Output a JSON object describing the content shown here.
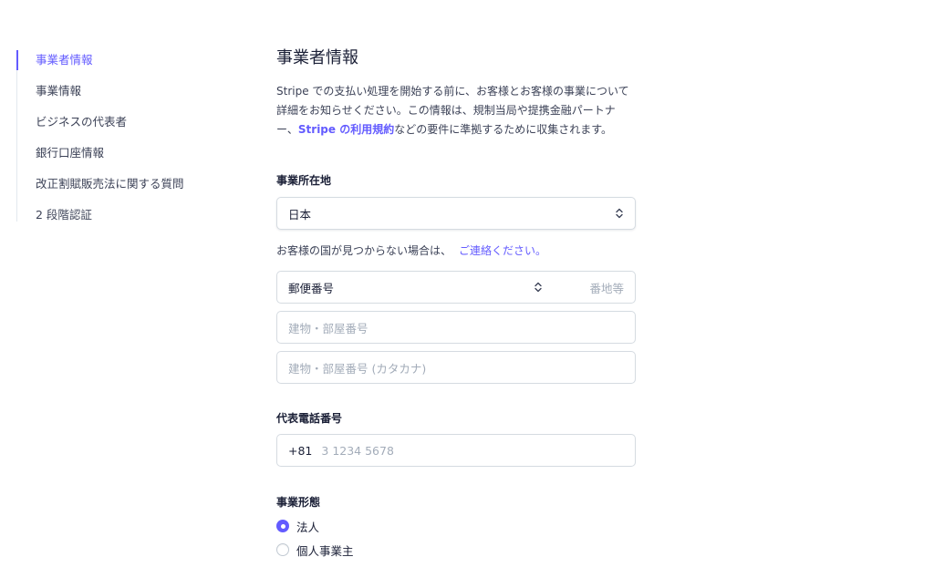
{
  "sidebar": {
    "items": [
      {
        "label": "事業者情報",
        "active": true
      },
      {
        "label": "事業情報"
      },
      {
        "label": "ビジネスの代表者"
      },
      {
        "label": "銀行口座情報"
      },
      {
        "label": "改正割賦販売法に関する質問"
      },
      {
        "label": "2 段階認証"
      }
    ]
  },
  "main": {
    "title": "事業者情報",
    "intro_before": "Stripe での支払い処理を開始する前に、お客様とお客様の事業について詳細をお知らせください。この情報は、規制当局や提携金融パートナー、",
    "intro_link": "Stripe の利用規約",
    "intro_after": "などの要件に準拠するために収集されます。",
    "address": {
      "label": "事業所在地",
      "country_value": "日本",
      "help_text": "お客様の国が見つからない場合は、",
      "help_link": "ご連絡ください。",
      "postal_placeholder": "郵便番号",
      "street_placeholder": "番地等",
      "building_placeholder": "建物・部屋番号",
      "building_kana_placeholder": "建物・部屋番号 (カタカナ)"
    },
    "phone": {
      "label": "代表電話番号",
      "prefix": "+81",
      "placeholder": "3 1234 5678"
    },
    "business_type": {
      "label": "事業形態",
      "options": [
        {
          "label": "法人",
          "selected": true
        },
        {
          "label": "個人事業主",
          "selected": false
        }
      ]
    }
  },
  "colors": {
    "accent": "#635bff",
    "text": "#1a1f36",
    "muted": "#a3acb9",
    "border": "#d5dbe1"
  }
}
